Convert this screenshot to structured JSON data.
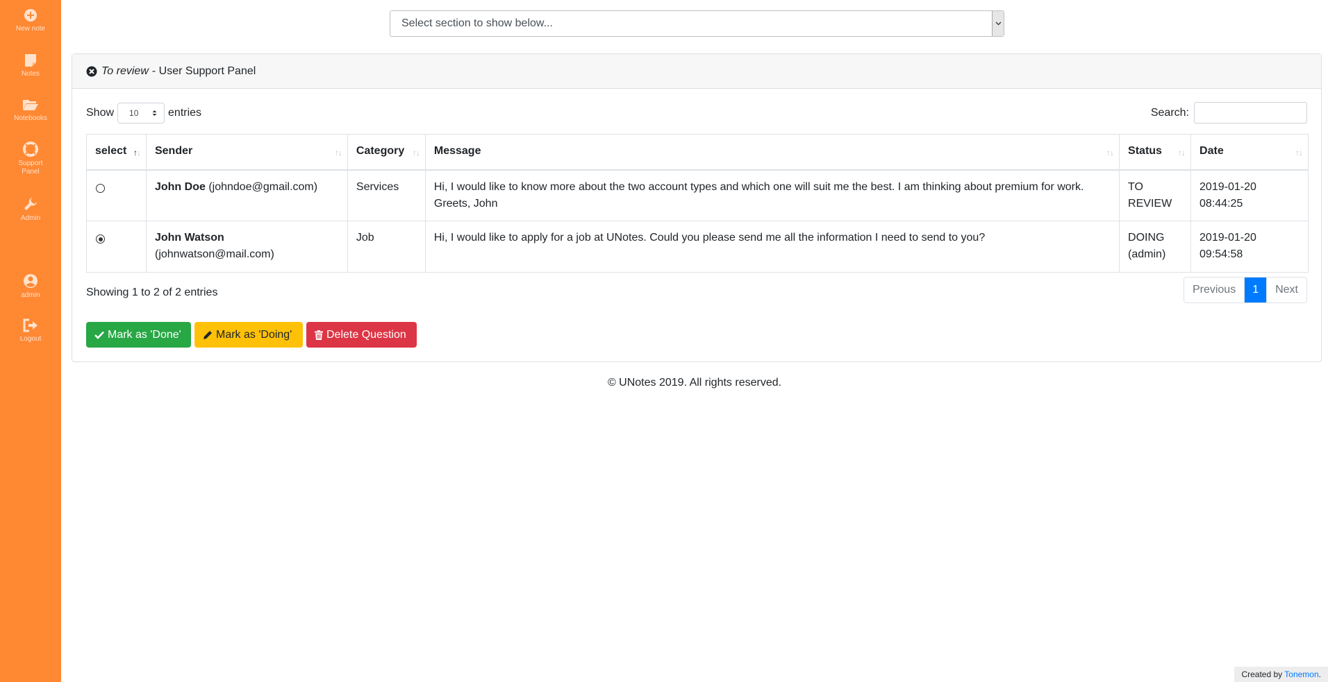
{
  "sidebar": {
    "items": [
      {
        "label": "New note",
        "icon": "plus-circle-icon"
      },
      {
        "label": "Notes",
        "icon": "note-icon"
      },
      {
        "label": "Notebooks",
        "icon": "folder-icon"
      },
      {
        "label": "Support Panel",
        "icon": "lifebuoy-icon"
      },
      {
        "label": "Admin",
        "icon": "wrench-icon"
      },
      {
        "label": "admin",
        "icon": "user-circle-icon"
      },
      {
        "label": "Logout",
        "icon": "logout-icon"
      }
    ]
  },
  "section_select": {
    "value": "Select section to show below..."
  },
  "panel": {
    "title_em": "To review",
    "title_rest": "- User Support Panel"
  },
  "table_controls": {
    "show_label": "Show",
    "entries_value": "10",
    "entries_label": "entries",
    "search_label": "Search:"
  },
  "table": {
    "columns": [
      "select",
      "Sender",
      "Category",
      "Message",
      "Status",
      "Date"
    ],
    "rows": [
      {
        "selected": false,
        "sender_name": "John Doe",
        "sender_email": "(johndoe@gmail.com)",
        "category": "Services",
        "message": "Hi, I would like to know more about the two account types and which one will suit me the best. I am thinking about premium for work. Greets, John",
        "status": "TO REVIEW",
        "date": "2019-01-20 08:44:25"
      },
      {
        "selected": true,
        "sender_name": "John Watson",
        "sender_email": "(johnwatson@mail.com)",
        "category": "Job",
        "message": "Hi, I would like to apply for a job at UNotes. Could you please send me all the information I need to send to you?",
        "status": "DOING (admin)",
        "date": "2019-01-20 09:54:58"
      }
    ]
  },
  "info": "Showing 1 to 2 of 2 entries",
  "pagination": {
    "previous": "Previous",
    "current": "1",
    "next": "Next"
  },
  "actions": {
    "done": "Mark as 'Done'",
    "doing": "Mark as 'Doing'",
    "delete": "Delete Question"
  },
  "footer": "© UNotes 2019. All rights reserved.",
  "credit": {
    "prefix": "Created by",
    "link": "Tonemon",
    "suffix": "."
  },
  "colors": {
    "sidebar": "#ff8833",
    "primary": "#007bff",
    "success": "#28a745",
    "warning": "#ffc107",
    "danger": "#dc3545"
  }
}
